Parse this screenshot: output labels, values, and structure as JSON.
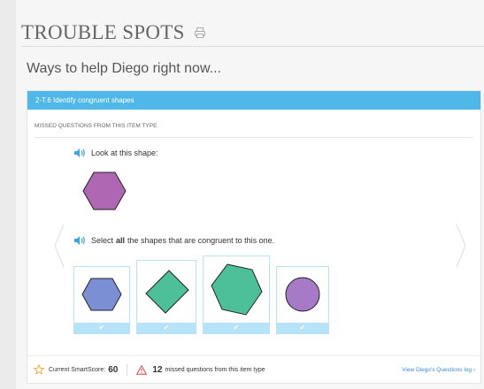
{
  "header": {
    "title": "TROUBLE SPOTS",
    "printer_icon": "printer-icon"
  },
  "subtitle": "Ways to help Diego right now...",
  "skill": {
    "label": "2-T.6 Identify congruent shapes",
    "accent": "#4fb8e8"
  },
  "missed_heading": "MISSED QUESTIONS FROM THIS ITEM TYPE",
  "question": {
    "prompt1": "Look at this shape:",
    "prompt2_pre": "Select",
    "prompt2_bold": "all",
    "prompt2_post": "the shapes that are congruent to this one.",
    "target_color": "#b067b3",
    "choices": [
      {
        "shape": "hexagon",
        "color": "#7b8fd4",
        "check": "✔"
      },
      {
        "shape": "diamond",
        "color": "#4dc09a",
        "check": "✔"
      },
      {
        "shape": "hexagon-large",
        "color": "#4dc09a",
        "check": "✔"
      },
      {
        "shape": "circle",
        "color": "#a77ac7",
        "check": "✔"
      }
    ]
  },
  "footer": {
    "score_label": "Current SmartScore:",
    "score": "60",
    "missed_count": "12",
    "missed_label": "missed questions from this item type",
    "log_link": "View Diego's Questions log ›"
  }
}
